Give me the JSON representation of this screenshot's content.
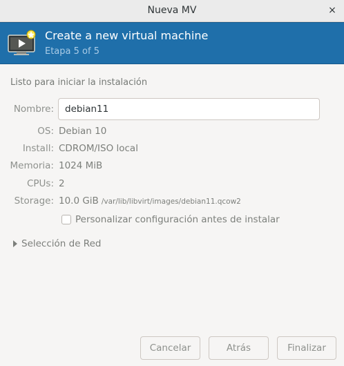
{
  "window": {
    "title": "Nueva MV",
    "close_glyph": "×"
  },
  "header": {
    "title": "Create a new virtual machine",
    "step": "Etapa 5 of 5",
    "icon": "monitor-play-new-icon",
    "background": "#1f6faa"
  },
  "summary": {
    "section_title": "Listo para iniciar la instalación",
    "name_label": "Nombre:",
    "name_value": "debian11",
    "os_label": "OS:",
    "os_value": "Debian 10",
    "install_label": "Install:",
    "install_value": "CDROM/ISO local",
    "memory_label": "Memoria:",
    "memory_value": "1024 MiB",
    "cpus_label": "CPUs:",
    "cpus_value": "2",
    "storage_label": "Storage:",
    "storage_value": "10.0 GiB",
    "storage_path": "/var/lib/libvirt/images/debian11.qcow2"
  },
  "customize": {
    "label": "Personalizar configuración antes de instalar",
    "checked": false
  },
  "network": {
    "label": "Selección de Red",
    "expanded": false
  },
  "buttons": {
    "cancel": "Cancelar",
    "back": "Atrás",
    "finish": "Finalizar"
  }
}
